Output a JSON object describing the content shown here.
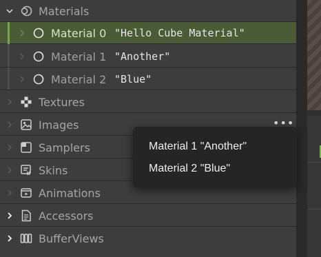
{
  "tree": {
    "materials": {
      "label": "Materials",
      "icon": "materials-icon",
      "children": [
        {
          "label": "Material 0",
          "name": "\"Hello Cube Material\""
        },
        {
          "label": "Material 1",
          "name": "\"Another\""
        },
        {
          "label": "Material 2",
          "name": "\"Blue\""
        }
      ]
    },
    "sections": [
      {
        "label": "Textures",
        "icon": "checker-icon"
      },
      {
        "label": "Images",
        "icon": "image-icon"
      },
      {
        "label": "Samplers",
        "icon": "sampler-icon"
      },
      {
        "label": "Skins",
        "icon": "skin-icon"
      },
      {
        "label": "Animations",
        "icon": "animation-icon"
      },
      {
        "label": "Accessors",
        "icon": "document-icon"
      },
      {
        "label": "BufferViews",
        "icon": "buffer-icon"
      }
    ]
  },
  "more_button": "•••",
  "context_menu": {
    "items": [
      "Material 1 \"Another\"",
      "Material 2 \"Blue\""
    ]
  },
  "colors": {
    "selection": "#4a5b35",
    "accent_green": "#78b64a",
    "menu_bg": "#252526"
  }
}
